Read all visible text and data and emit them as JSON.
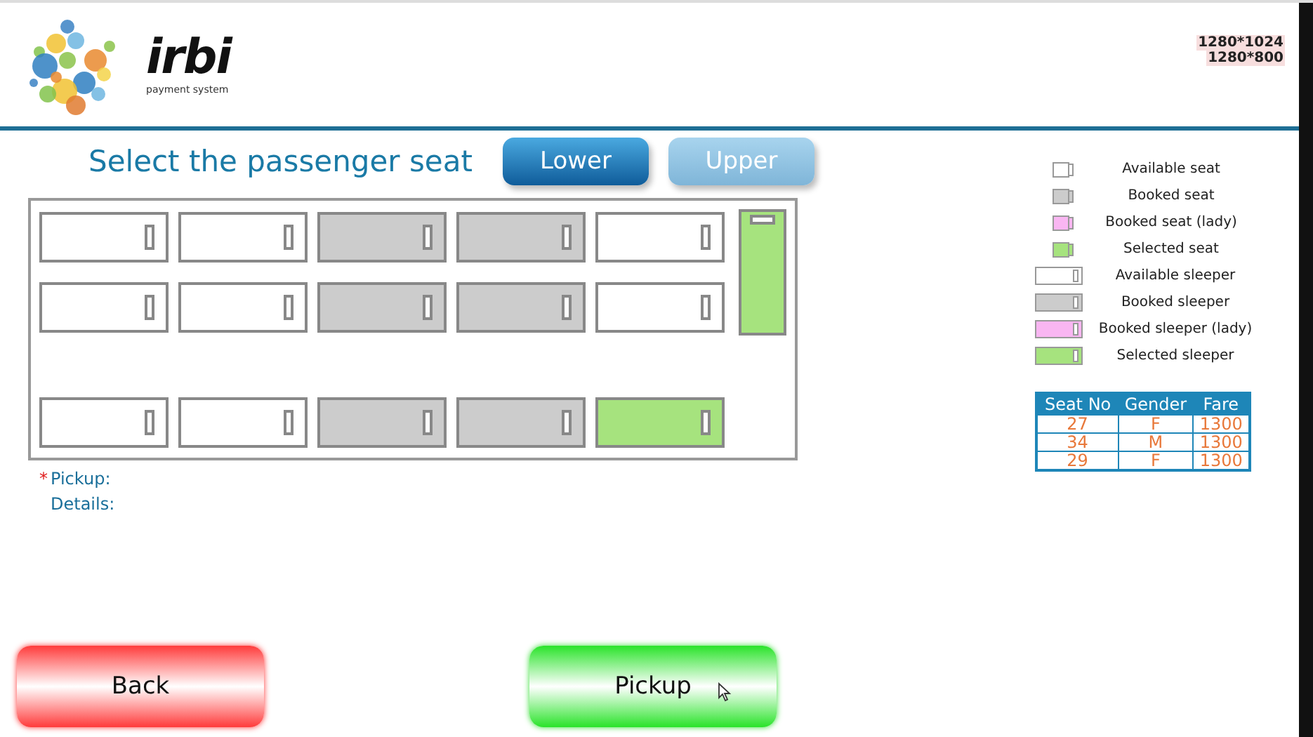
{
  "logo": {
    "name": "irbi",
    "tagline": "payment system"
  },
  "resolutions": [
    "1280*1024",
    "1280*800"
  ],
  "title": "Select the passenger seat",
  "deck_tabs": [
    {
      "label": "Lower",
      "selected": true
    },
    {
      "label": "Upper",
      "selected": false
    }
  ],
  "deck_sections": [
    {
      "rows": [
        [
          {
            "kind": "available"
          },
          {
            "kind": "available"
          },
          {
            "kind": "booked"
          },
          {
            "kind": "booked"
          },
          {
            "kind": "available"
          }
        ],
        [
          {
            "kind": "available"
          },
          {
            "kind": "available"
          },
          {
            "kind": "booked"
          },
          {
            "kind": "booked"
          },
          {
            "kind": "available"
          }
        ]
      ],
      "side_berths": [
        {
          "kind": "selected"
        }
      ]
    },
    {
      "rows": [
        [
          {
            "kind": "available"
          },
          {
            "kind": "available"
          },
          {
            "kind": "booked"
          },
          {
            "kind": "booked"
          },
          {
            "kind": "selected"
          }
        ]
      ]
    }
  ],
  "fields": [
    {
      "marker": "*",
      "label": "Pickup:"
    },
    {
      "label": "Details:"
    }
  ],
  "seat_legend": [
    {
      "kind": "available",
      "label": "Available seat"
    },
    {
      "kind": "booked",
      "label": "Booked seat"
    },
    {
      "kind": "booked_lady",
      "label": "Booked seat (lady)"
    },
    {
      "kind": "selected",
      "label": "Selected seat"
    }
  ],
  "sleeper_legend": [
    {
      "kind": "available",
      "label": "Available sleeper"
    },
    {
      "kind": "booked",
      "label": "Booked sleeper"
    },
    {
      "kind": "booked_lady",
      "label": "Booked sleeper (lady)"
    },
    {
      "kind": "selected",
      "label": "Selected sleeper"
    }
  ],
  "selection_table": {
    "columns": [
      "Seat No",
      "Gender",
      "Fare"
    ],
    "rows": [
      [
        "27",
        "F",
        "1300"
      ],
      [
        "34",
        "M",
        "1300"
      ],
      [
        "29",
        "F",
        "1300"
      ]
    ]
  },
  "buttons": [
    {
      "kind": "back",
      "label": "Back"
    },
    {
      "kind": "pickup",
      "label": "Pickup"
    }
  ]
}
